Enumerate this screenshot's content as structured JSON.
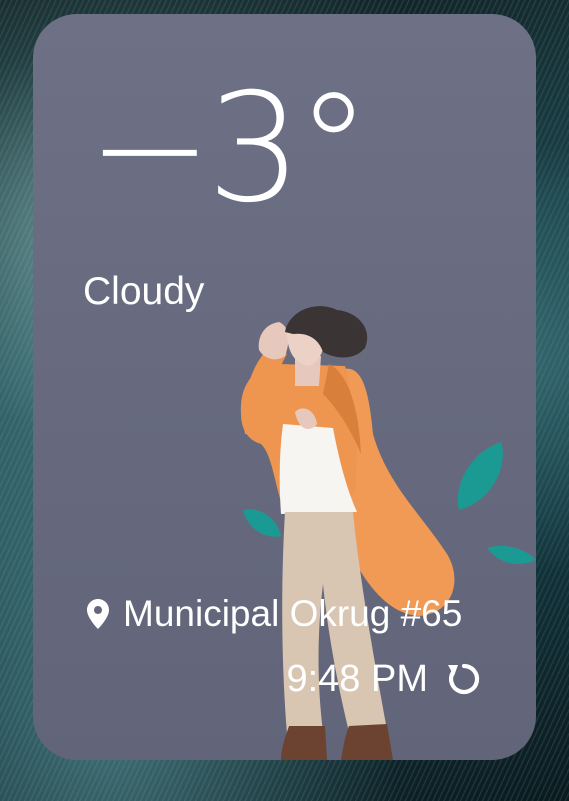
{
  "widget": {
    "temperature": "−3°",
    "condition": "Cloudy",
    "location": "Municipal Okrug #65",
    "time": "9:48 PM"
  },
  "icons": {
    "location": "map-pin-icon",
    "refresh": "refresh-icon"
  },
  "colors": {
    "card_background": "#6a6d82",
    "text": "#ffffff",
    "coat": "#f09a55",
    "leaf": "#1b9a94",
    "pants": "#d8c6b2",
    "boots": "#6b4330",
    "hair": "#3a3534"
  }
}
